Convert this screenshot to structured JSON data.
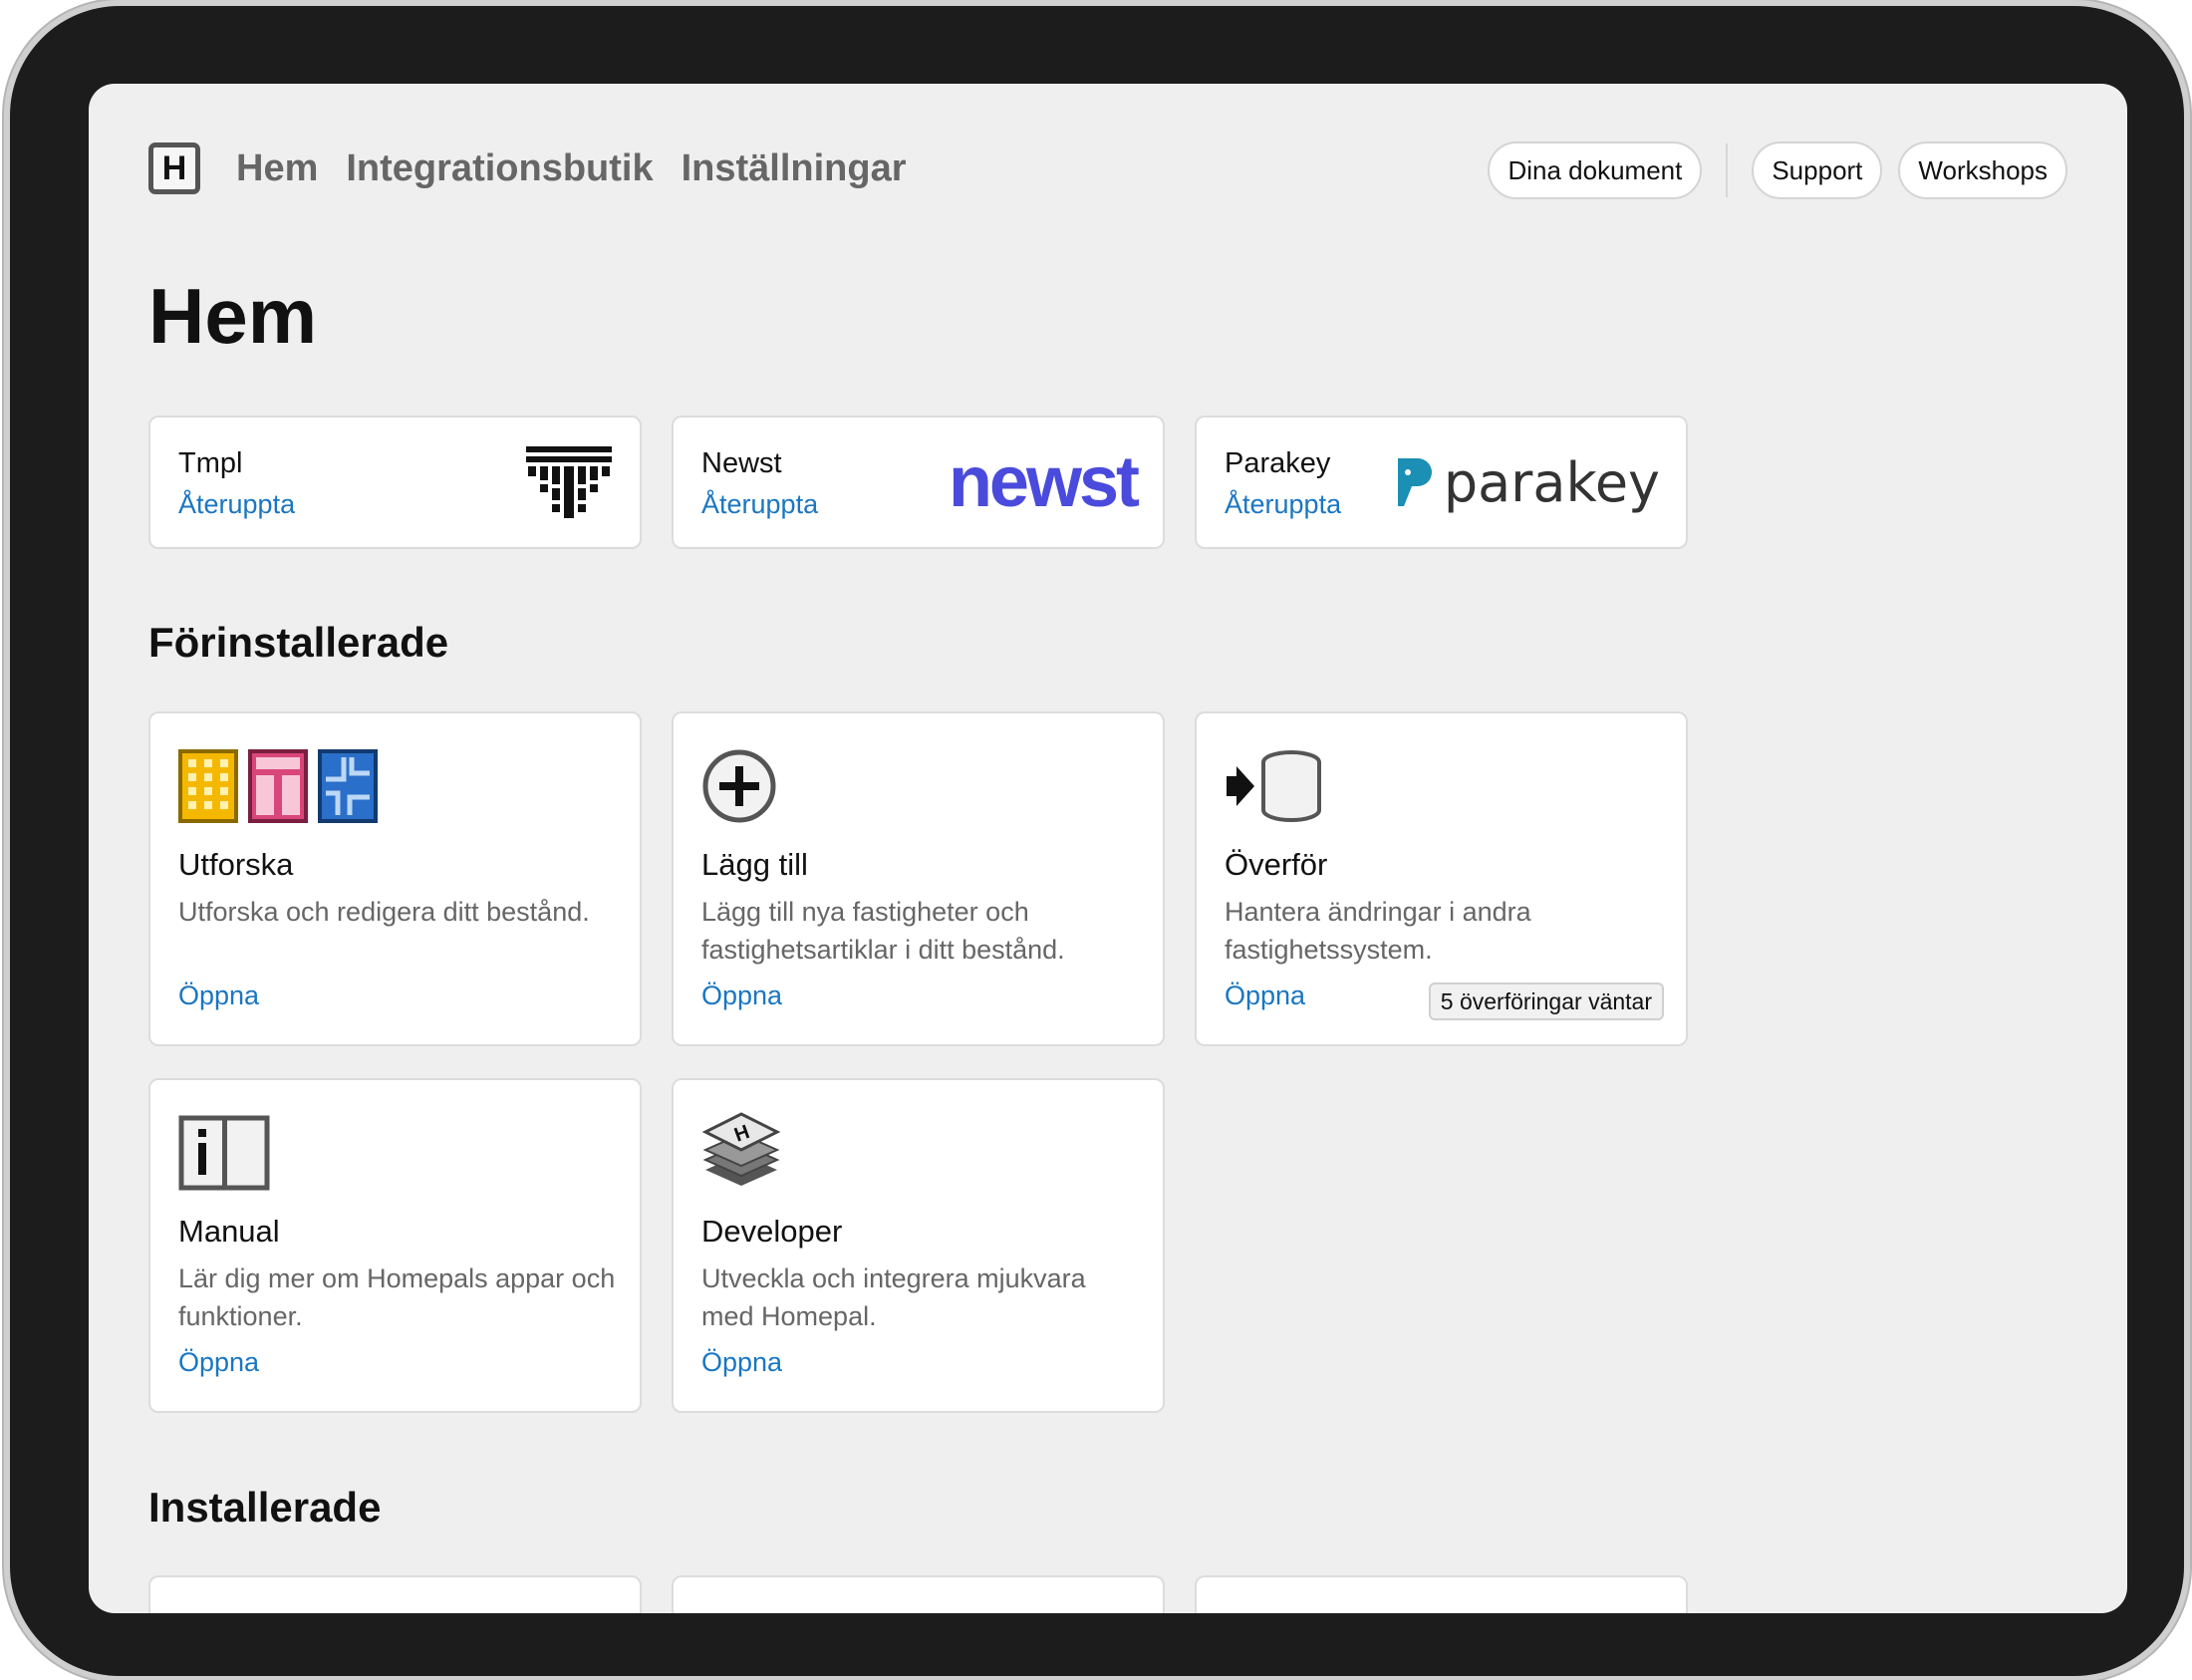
{
  "header": {
    "logo_letter": "H",
    "nav": [
      "Hem",
      "Integrationsbutik",
      "Inställningar"
    ],
    "actions": [
      "Dina dokument",
      "Support",
      "Workshops"
    ]
  },
  "page_title": "Hem",
  "resume": [
    {
      "name": "Tmpl",
      "link": "Återuppta",
      "brand": "tmpl-logo"
    },
    {
      "name": "Newst",
      "link": "Återuppta",
      "brand_text": "newst",
      "brand_color": "#4a4bdc"
    },
    {
      "name": "Parakey",
      "link": "Återuppta",
      "brand_text": "parakey",
      "brand_color": "#1b8fb4"
    }
  ],
  "preinstalled": {
    "title": "Förinstallerade",
    "apps": [
      {
        "title": "Utforska",
        "desc": "Utforska och redigera ditt bestånd.",
        "open": "Öppna"
      },
      {
        "title": "Lägg till",
        "desc": "Lägg till nya fastigheter och fastighetsartiklar i ditt bestånd.",
        "open": "Öppna"
      },
      {
        "title": "Överför",
        "desc": "Hantera ändringar i andra fastighetssystem.",
        "open": "Öppna",
        "badge": "5 överföringar väntar"
      },
      {
        "title": "Manual",
        "desc": "Lär dig mer om Homepals appar och funktioner.",
        "open": "Öppna"
      },
      {
        "title": "Developer",
        "desc": "Utveckla och integrera mjukvara med Homepal.",
        "open": "Öppna"
      }
    ]
  },
  "installed": {
    "title": "Installerade"
  },
  "colors": {
    "link": "#1a76c2",
    "yellow": "#f5b800",
    "pink": "#d9467a",
    "blue": "#2a6fc9"
  }
}
